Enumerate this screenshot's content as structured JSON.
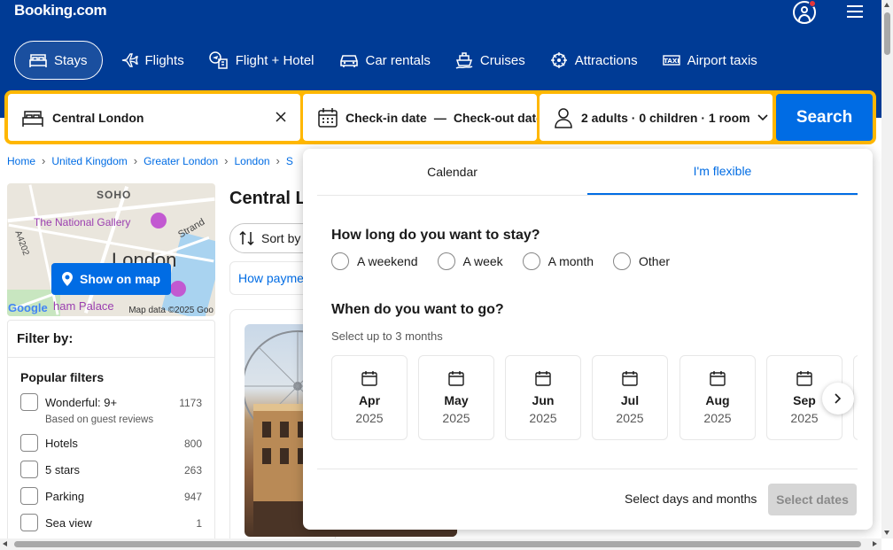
{
  "header": {
    "logo": "Booking.com",
    "nav": [
      {
        "label": "Stays",
        "icon": "bed-icon",
        "active": true
      },
      {
        "label": "Flights",
        "icon": "plane-icon"
      },
      {
        "label": "Flight + Hotel",
        "icon": "flight-hotel-icon"
      },
      {
        "label": "Car rentals",
        "icon": "car-icon"
      },
      {
        "label": "Cruises",
        "icon": "ship-icon"
      },
      {
        "label": "Attractions",
        "icon": "attractions-icon"
      },
      {
        "label": "Airport taxis",
        "icon": "taxi-icon"
      }
    ]
  },
  "search": {
    "destination": "Central London",
    "checkin_placeholder": "Check-in date",
    "dash": "—",
    "checkout_placeholder": "Check-out date",
    "guests": "2 adults · 0 children · 1 room",
    "button": "Search"
  },
  "breadcrumb": [
    "Home",
    "United Kingdom",
    "Greater London",
    "London",
    "S"
  ],
  "map": {
    "labels": [
      "SOHO",
      "The National Gallery",
      "Strand",
      "A4202",
      "London",
      "ham Palace"
    ],
    "button": "Show on map",
    "credit": "Map data ©2025 Goo",
    "google": "Google"
  },
  "filters": {
    "title": "Filter by:",
    "section": "Popular filters",
    "items": [
      {
        "label": "Wonderful: 9+",
        "hint": "Based on guest reviews",
        "count": "1173"
      },
      {
        "label": "Hotels",
        "count": "800"
      },
      {
        "label": "5 stars",
        "count": "263"
      },
      {
        "label": "Parking",
        "count": "947"
      },
      {
        "label": "Sea view",
        "count": "1"
      }
    ]
  },
  "results": {
    "title": "Central L",
    "sort": "Sort by",
    "payment": "How payme"
  },
  "popup": {
    "tabs": [
      "Calendar",
      "I'm flexible"
    ],
    "active_tab": "I'm flexible",
    "q_length": "How long do you want to stay?",
    "length_options": [
      "A weekend",
      "A week",
      "A month",
      "Other"
    ],
    "q_when": "When do you want to go?",
    "when_hint": "Select up to 3 months",
    "months": [
      {
        "month": "Apr",
        "year": "2025"
      },
      {
        "month": "May",
        "year": "2025"
      },
      {
        "month": "Jun",
        "year": "2025"
      },
      {
        "month": "Jul",
        "year": "2025"
      },
      {
        "month": "Aug",
        "year": "2025"
      },
      {
        "month": "Sep",
        "year": "2025"
      }
    ],
    "footer_text": "Select days and months",
    "select_button": "Select dates"
  },
  "colors": {
    "brand_blue": "#003b95",
    "accent_blue": "#006ce4",
    "search_yellow": "#ffb700"
  }
}
